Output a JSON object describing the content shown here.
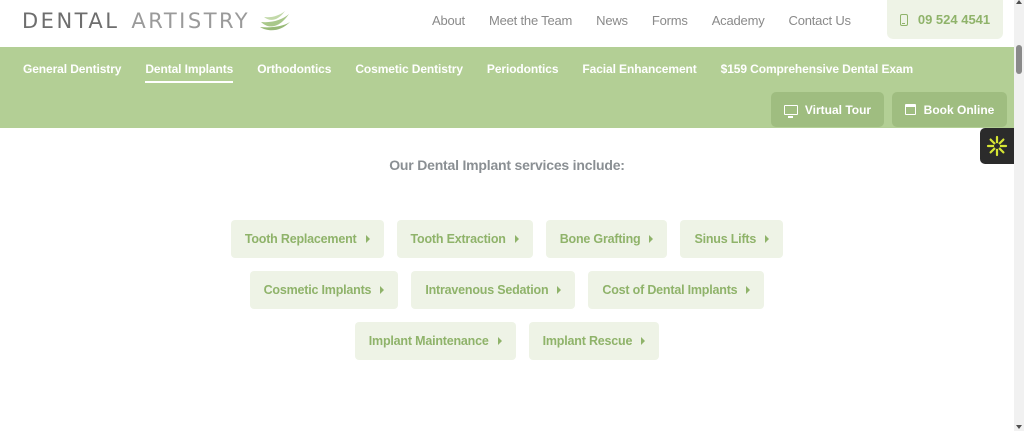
{
  "brand": {
    "word1": "DENTAL",
    "word2": "ARTISTRY"
  },
  "top_nav": [
    "About",
    "Meet the Team",
    "News",
    "Forms",
    "Academy",
    "Contact Us"
  ],
  "phone": "09 524 4541",
  "sub_nav": {
    "items": [
      "General Dentistry",
      "Dental Implants",
      "Orthodontics",
      "Cosmetic Dentistry",
      "Periodontics",
      "Facial Enhancement",
      "$159 Comprehensive Dental Exam"
    ],
    "active": "Dental Implants"
  },
  "actions": {
    "virtual_tour": "Virtual Tour",
    "book_online": "Book Online"
  },
  "content": {
    "heading": "Our Dental Implant services include:",
    "services": [
      [
        "Tooth Replacement",
        "Tooth Extraction",
        "Bone Grafting",
        "Sinus Lifts"
      ],
      [
        "Cosmetic Implants",
        "Intravenous Sedation",
        "Cost of Dental Implants"
      ],
      [
        "Implant Maintenance",
        "Implant Rescue"
      ]
    ]
  },
  "colors": {
    "accent": "#8fb36a",
    "band": "#b3cf95",
    "pill_bg": "#eef3e6",
    "text_gray": "#8a8a8a"
  },
  "icons": {
    "logo": "leaf-icon",
    "phone": "mobile-phone-icon",
    "tour": "monitor-icon",
    "book": "calendar-icon",
    "a11y": "accessibility-icon",
    "caret": "caret-right-icon"
  }
}
